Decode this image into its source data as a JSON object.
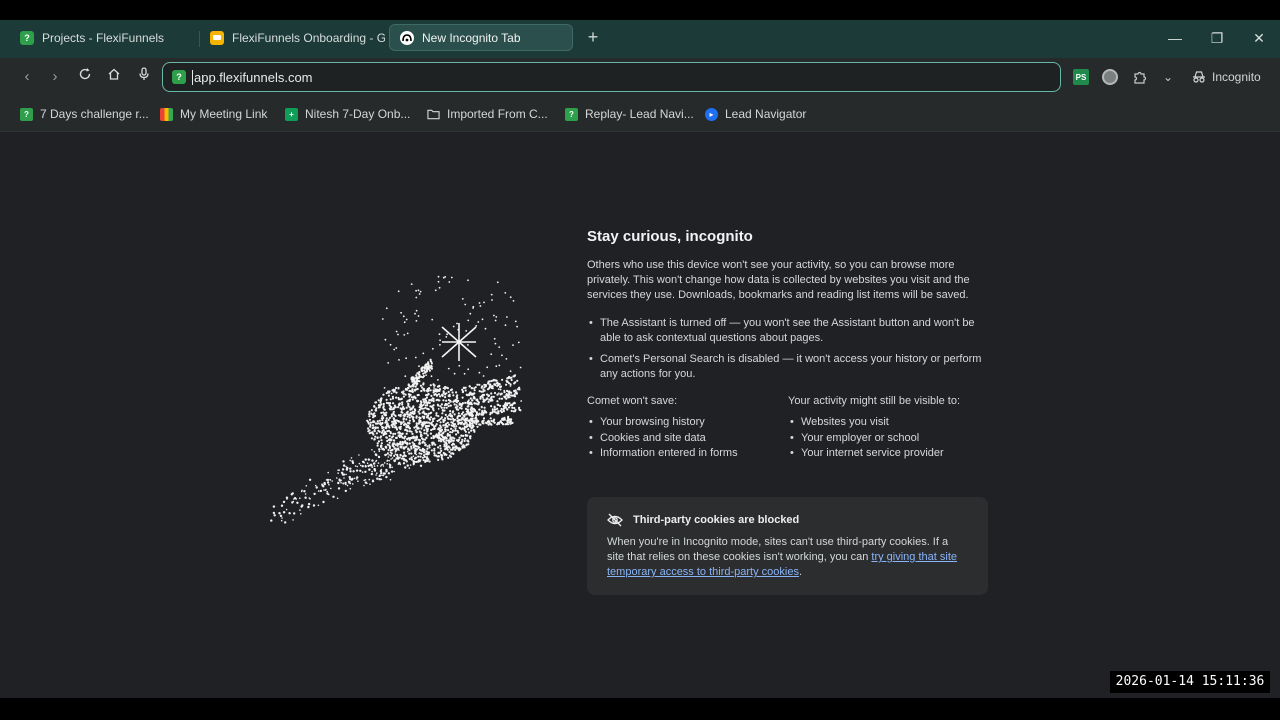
{
  "tabs": [
    {
      "label": "Projects - FlexiFunnels",
      "icon": "flexifunnels-favicon",
      "color": "#2e9f4a",
      "active": false
    },
    {
      "label": "FlexiFunnels Onboarding - Go",
      "icon": "google-slides-favicon",
      "color": "#f4b400",
      "active": false
    },
    {
      "label": "New Incognito Tab",
      "icon": "incognito-favicon",
      "color": "#000000",
      "active": true
    }
  ],
  "toolbar": {
    "url": "app.flexifunnels.com",
    "incognito_label": "Incognito",
    "ps_ext_label": "PS"
  },
  "bookmarks": [
    {
      "label": "7 Days challenge r...",
      "icon": "flexifunnels-favicon",
      "color": "#2e9f4a"
    },
    {
      "label": "My Meeting Link",
      "icon": "google-meet-favicon",
      "color": "#00897b"
    },
    {
      "label": "Nitesh 7-Day Onb...",
      "icon": "google-sheets-favicon",
      "color": "#0f9d58"
    },
    {
      "label": "Imported From C...",
      "icon": "folder-icon",
      "color": "#d3d7d7"
    },
    {
      "label": "Replay- Lead Navi...",
      "icon": "flexifunnels-favicon",
      "color": "#2e9f4a"
    },
    {
      "label": "Lead Navigator",
      "icon": "lead-navigator-favicon",
      "color": "#1e6ff2"
    }
  ],
  "incognito": {
    "title": "Stay curious, incognito",
    "intro": "Others who use this device won't see your activity, so you can browse more privately. This won't change how data is collected by websites you visit and the services they use. Downloads, bookmarks and reading list items will be saved.",
    "bullets": [
      "The Assistant is turned off — you won't see the Assistant button and won't be able to ask contextual questions about pages.",
      "Comet's Personal Search is disabled — it won't access your history or perform any actions for you."
    ],
    "wont_save_title": "Comet won't save:",
    "wont_save": [
      "Your browsing history",
      "Cookies and site data",
      "Information entered in forms"
    ],
    "visible_title": "Your activity might still be visible to:",
    "visible": [
      "Websites you visit",
      "Your employer or school",
      "Your internet service provider"
    ],
    "cookies_title": "Third-party cookies are blocked",
    "cookies_body": "When you're in Incognito mode, sites can't use third-party cookies. If a site that relies on these cookies isn't working, you can ",
    "cookies_link": "try giving that site temporary access to third-party cookies",
    "cookies_end": "."
  },
  "timestamp": "2026-01-14  15:11:36"
}
